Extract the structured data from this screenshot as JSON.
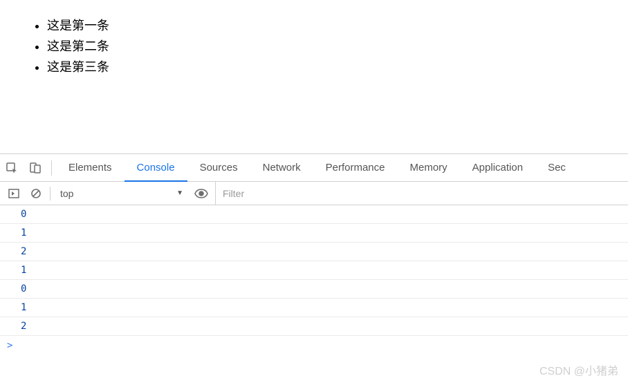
{
  "page": {
    "list_items": [
      "这是第一条",
      "这是第二条",
      "这是第三条"
    ]
  },
  "devtools": {
    "tabs": [
      "Elements",
      "Console",
      "Sources",
      "Network",
      "Performance",
      "Memory",
      "Application",
      "Sec"
    ],
    "active_tab_index": 1,
    "context_selector": "top",
    "filter_placeholder": "Filter",
    "logs": [
      "0",
      "1",
      "2",
      "1",
      "0",
      "1",
      "2"
    ],
    "prompt_symbol": ">"
  },
  "watermark": "CSDN @小猪弟"
}
